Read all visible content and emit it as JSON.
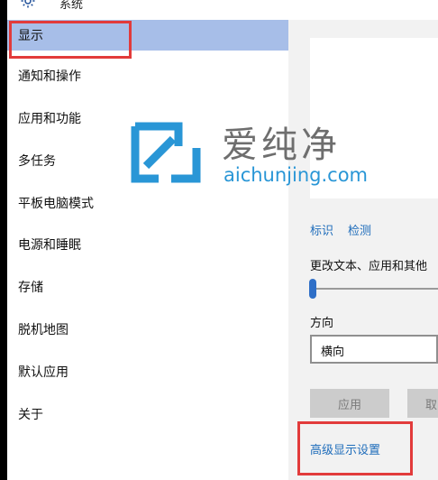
{
  "window": {
    "title": "系统",
    "icon": "gear-icon"
  },
  "sidebar": {
    "items": [
      {
        "label": "显示",
        "selected": true
      },
      {
        "label": "通知和操作",
        "selected": false
      },
      {
        "label": "应用和功能",
        "selected": false
      },
      {
        "label": "多任务",
        "selected": false
      },
      {
        "label": "平板电脑模式",
        "selected": false
      },
      {
        "label": "电源和睡眠",
        "selected": false
      },
      {
        "label": "存储",
        "selected": false
      },
      {
        "label": "脱机地图",
        "selected": false
      },
      {
        "label": "默认应用",
        "selected": false
      },
      {
        "label": "关于",
        "selected": false
      }
    ]
  },
  "display": {
    "identify_link": "标识",
    "detect_link": "检测",
    "scale_label": "更改文本、应用和其他",
    "scale_level": 0,
    "orientation_label": "方向",
    "orientation_value": "横向",
    "apply_label": "应用",
    "cancel_label": "取",
    "advanced_link": "高级显示设置"
  },
  "watermark": {
    "cn": "爱纯净",
    "en": "aichunjing.com"
  },
  "colors": {
    "selected_bg": "#a7bee8",
    "link": "#1f6dbb",
    "highlight": "#e23b3b",
    "slider": "#2f6fc7"
  }
}
